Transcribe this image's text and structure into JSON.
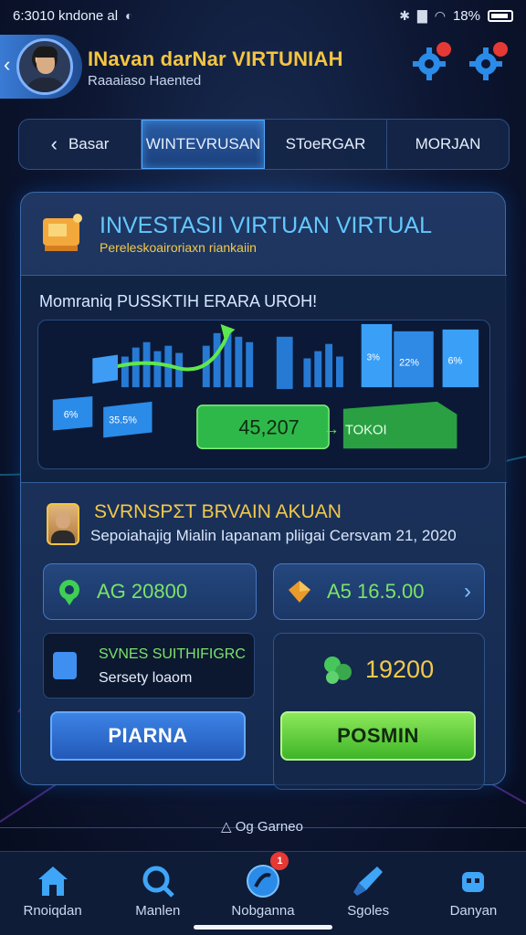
{
  "status_bar": {
    "time": "6:3010 kndone al",
    "battery": "18%"
  },
  "header": {
    "title": "INavan darNar VIRTUNIAH",
    "subtitle": "Raaaiaso Haented"
  },
  "tabs": [
    "Basar",
    "WINTEVRUSAN",
    "SToeRGAR",
    "MORJAN"
  ],
  "card": {
    "title": "INVESTASII VIRTUAN VIRTUAL",
    "subtitle": "Pereleskoairoriaxn riankaiin"
  },
  "chart_panel": {
    "heading": "Momraniq PUSSKTIH ERARA UROH!",
    "left_labels": [
      "6%",
      "35.5%"
    ],
    "cube_labels": [
      "3%",
      "22%",
      "6%"
    ],
    "bar_value": "45,207",
    "bar_target": "TOKOI"
  },
  "account": {
    "title": "SVRNSPΣT BRVAIN AKUAN",
    "description": "Sepoiahajig Mialin Iapanam pliigai Cersvam 21, 2020",
    "stat_1": "AG 20800",
    "stat_2": "A5 16.5.00",
    "survey_title": "SVNES SUITHIFIGRC",
    "survey_sub": "Sersety loaom",
    "reward_value": "19200",
    "button_primary": "PIARNA",
    "button_success": "POSMIN"
  },
  "footer_label": "Og Garneo",
  "nav": [
    {
      "label": "Rnoiqdan",
      "icon": "home-icon"
    },
    {
      "label": "Manlen",
      "icon": "search-icon"
    },
    {
      "label": "Nobganna",
      "icon": "game-icon",
      "badge": "1"
    },
    {
      "label": "Sgoles",
      "icon": "rocket-icon"
    },
    {
      "label": "Danyan",
      "icon": "robot-icon"
    }
  ],
  "colors": {
    "accent_blue": "#4fa8ff",
    "gold": "#f3c94b",
    "green": "#7be36b",
    "background": "#0d1733"
  }
}
